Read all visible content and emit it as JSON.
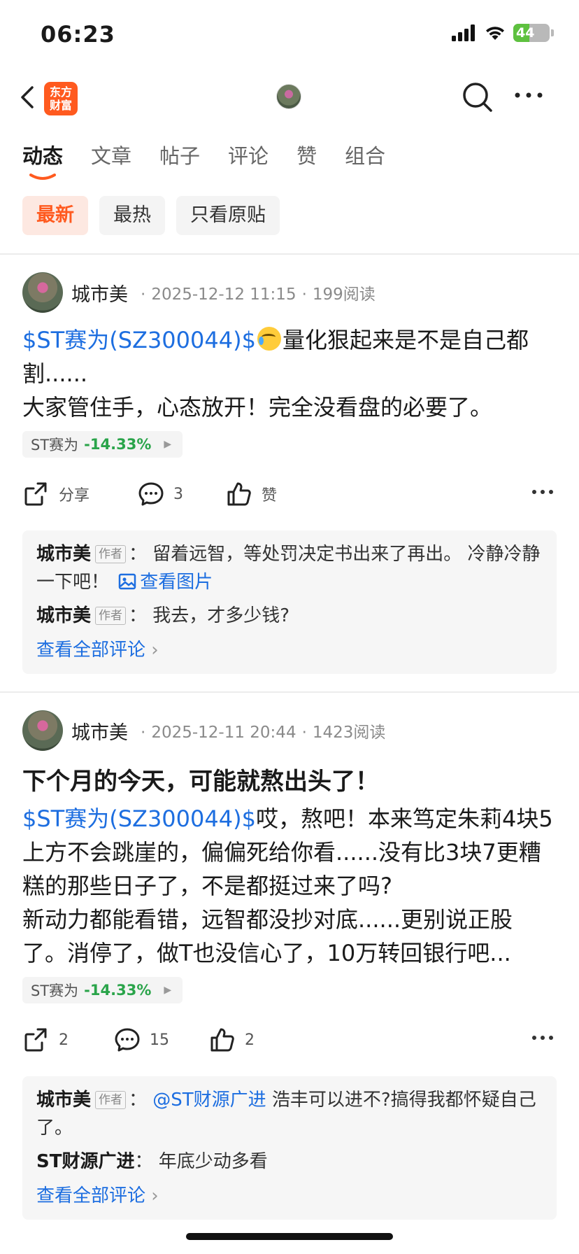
{
  "status_bar": {
    "time": "06:23",
    "battery": "44"
  },
  "header": {
    "logo_text": "东方\n财富"
  },
  "tabs": [
    "动态",
    "文章",
    "帖子",
    "评论",
    "赞",
    "组合"
  ],
  "filters": [
    "最新",
    "最热",
    "只看原贴"
  ],
  "posts": [
    {
      "author": "城市美",
      "date": "2025-12-12 11:15",
      "reads": "199阅读",
      "title": "",
      "stock_link": "$ST赛为(SZ300044)$",
      "content_line1_after_link": "量化狠起来是不是自己都割......",
      "content_line2": "大家管住手，心态放开！完全没看盘的必要了。",
      "chip": {
        "name": "ST赛为",
        "change": "-14.33%"
      },
      "actions": {
        "share": "分享",
        "comments": "3",
        "likes": "赞"
      },
      "comments": [
        {
          "name": "城市美",
          "badge": "作者",
          "text": "留着远智，等处罚决定书出来了再出。  冷静冷静一下吧！",
          "image_link": "查看图片"
        },
        {
          "name": "城市美",
          "badge": "作者",
          "text": "我去，才多少钱?"
        }
      ],
      "view_all": "查看全部评论"
    },
    {
      "author": "城市美",
      "date": "2025-12-11 20:44",
      "reads": "1423阅读",
      "title": "下个月的今天，可能就熬出头了！",
      "stock_link": "$ST赛为(SZ300044)$",
      "content_after_link": "哎，熬吧！本来笃定朱莉4块5上方不会跳崖的，偏偏死给你看......没有比3块7更糟糕的那些日子了，不是都挺过来了吗?",
      "content_line2": "新动力都能看错，远智都没抄对底......更别说正股了。消停了，做T也没信心了，10万转回银行吧...",
      "chip": {
        "name": "ST赛为",
        "change": "-14.33%"
      },
      "actions": {
        "share": "2",
        "comments": "15",
        "likes": "2"
      },
      "comments": [
        {
          "name": "城市美",
          "badge": "作者",
          "mention": "@ST财源广进",
          "text": " 浩丰可以进不?搞得我都怀疑自己了。"
        },
        {
          "name": "ST财源广进",
          "text": "年底少动多看"
        }
      ],
      "view_all": "查看全部评论"
    }
  ],
  "colors": {
    "accent": "#ff5a1f",
    "link": "#1d6ee0",
    "down": "#2aa44a"
  }
}
